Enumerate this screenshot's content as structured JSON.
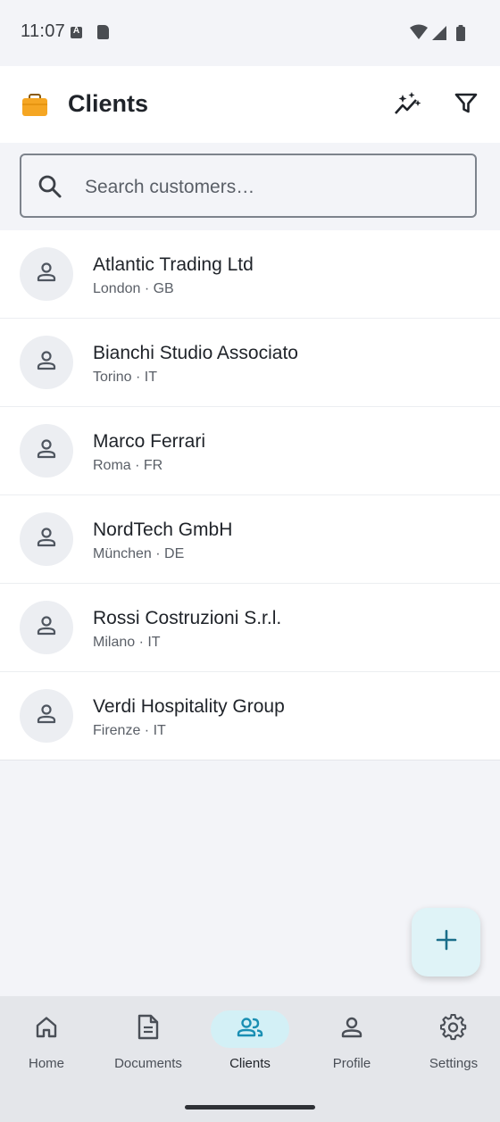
{
  "status_bar": {
    "time": "11:07",
    "icons": [
      "a-notification-icon",
      "sd-card-icon",
      "wifi-icon",
      "signal-icon",
      "battery-icon"
    ]
  },
  "app_bar": {
    "title": "Clients",
    "icon": "briefcase-icon",
    "icon_color": "#F5A623",
    "actions": [
      {
        "name": "insights-icon"
      },
      {
        "name": "filter-icon"
      }
    ]
  },
  "search": {
    "placeholder": "Search customers…",
    "value": ""
  },
  "clients": [
    {
      "name": "Atlantic Trading Ltd",
      "meta": "London · GB"
    },
    {
      "name": "Bianchi Studio Associato",
      "meta": "Torino · IT"
    },
    {
      "name": "Marco Ferrari",
      "meta": "Roma · FR"
    },
    {
      "name": "NordTech GmbH",
      "meta": "München · DE"
    },
    {
      "name": "Rossi Costruzioni S.r.l.",
      "meta": "Milano · IT"
    },
    {
      "name": "Verdi Hospitality Group",
      "meta": "Firenze · IT"
    }
  ],
  "fab": {
    "icon": "plus-icon",
    "color": "#1A6E8A"
  },
  "bottom_nav": {
    "active": "Clients",
    "accent": "#1A8FB3",
    "items": [
      {
        "label": "Home",
        "icon": "home-icon"
      },
      {
        "label": "Documents",
        "icon": "document-icon"
      },
      {
        "label": "Clients",
        "icon": "people-icon"
      },
      {
        "label": "Profile",
        "icon": "person-icon"
      },
      {
        "label": "Settings",
        "icon": "gear-icon"
      }
    ]
  }
}
